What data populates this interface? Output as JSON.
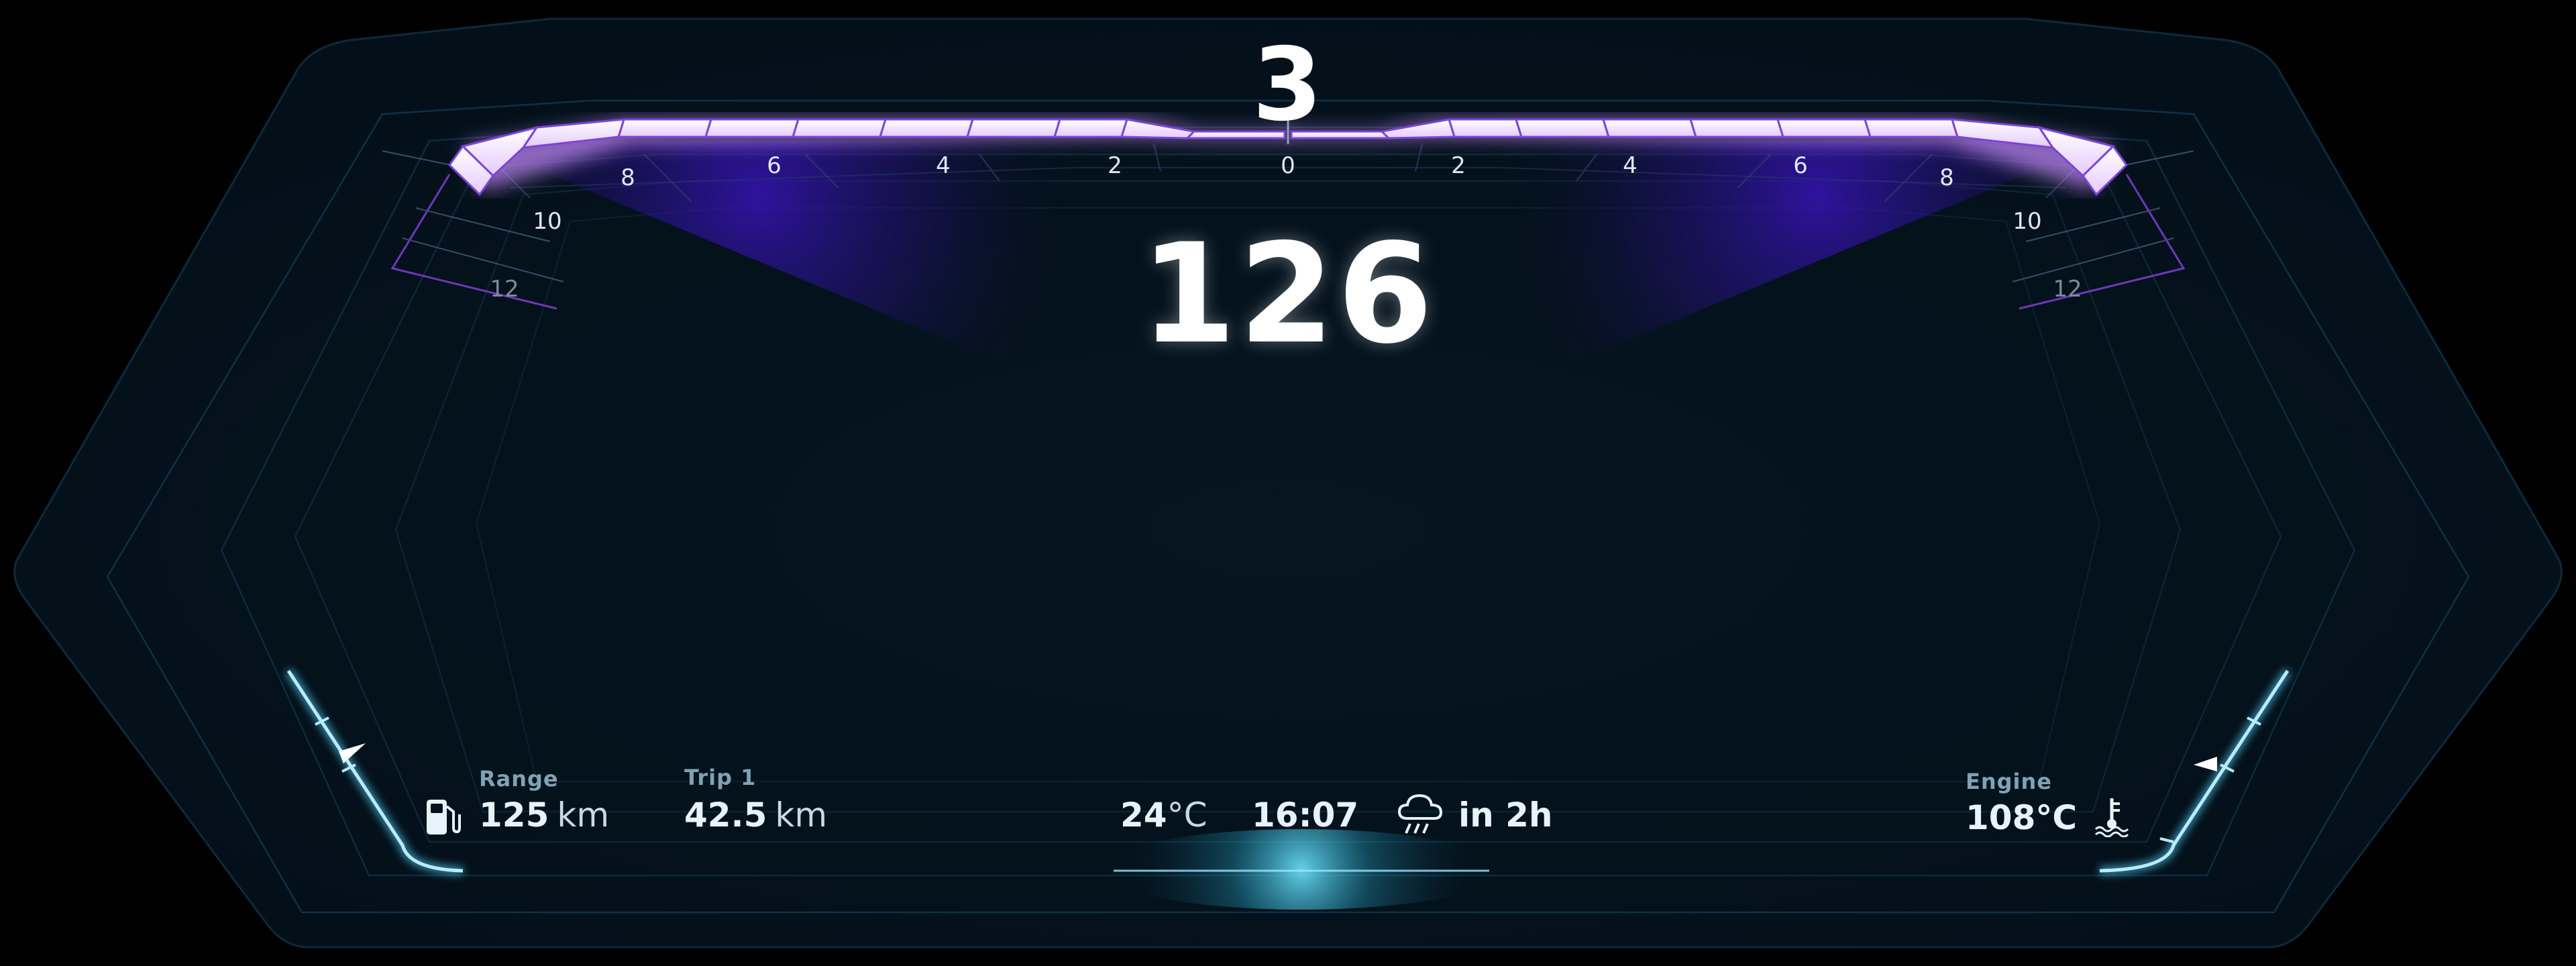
{
  "gear": "3",
  "speed": "126",
  "rpm_scale": {
    "left": [
      "8",
      "6",
      "4",
      "2",
      "0"
    ],
    "right": [
      "2",
      "4",
      "6",
      "8"
    ],
    "left_outer": [
      "10",
      "12"
    ],
    "right_outer": [
      "10",
      "12"
    ]
  },
  "range": {
    "label": "Range",
    "value": "125",
    "unit": "km",
    "icon": "fuel-pump-icon"
  },
  "trip": {
    "label": "Trip 1",
    "value": "42.5",
    "unit": "km"
  },
  "outside_temp": {
    "value": "24",
    "unit": "°C"
  },
  "clock": "16:07",
  "weather": {
    "icon": "rain-cloud-icon",
    "text": "in 2h"
  },
  "engine": {
    "label": "Engine",
    "value": "108°C",
    "icon": "coolant-temperature-icon"
  },
  "colors": {
    "background": "#000000",
    "panel": "#05111c",
    "accent_purple": "#8a3cf0",
    "accent_cyan": "#52c8f0",
    "text": "#e6f3fb",
    "muted": "#7fa2b4"
  }
}
